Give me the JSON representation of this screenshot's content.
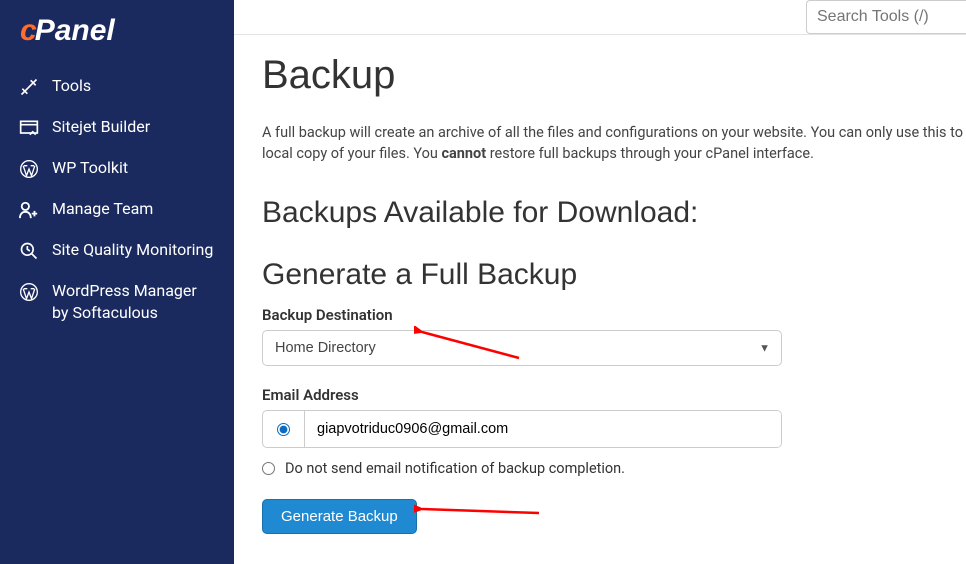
{
  "brand": "cPanel",
  "search": {
    "placeholder": "Search Tools (/)"
  },
  "sidebar": {
    "items": [
      {
        "label": "Tools"
      },
      {
        "label": "Sitejet Builder"
      },
      {
        "label": "WP Toolkit"
      },
      {
        "label": "Manage Team"
      },
      {
        "label": "Site Quality Monitoring"
      },
      {
        "label": "WordPress Manager by Softaculous"
      }
    ]
  },
  "page": {
    "title": "Backup",
    "desc_prefix": "A full backup will create an archive of all the files and configurations on your website. You can only use this to local copy of your files. You ",
    "desc_bold": "cannot",
    "desc_suffix": " restore full backups through your cPanel interface.",
    "h2": "Backups Available for Download:",
    "h3": "Generate a Full Backup",
    "dest_label": "Backup Destination",
    "dest_value": "Home Directory",
    "email_label": "Email Address",
    "email_value": "giapvotriduc0906@gmail.com",
    "no_email_label": "Do not send email notification of backup completion.",
    "button": "Generate Backup"
  }
}
